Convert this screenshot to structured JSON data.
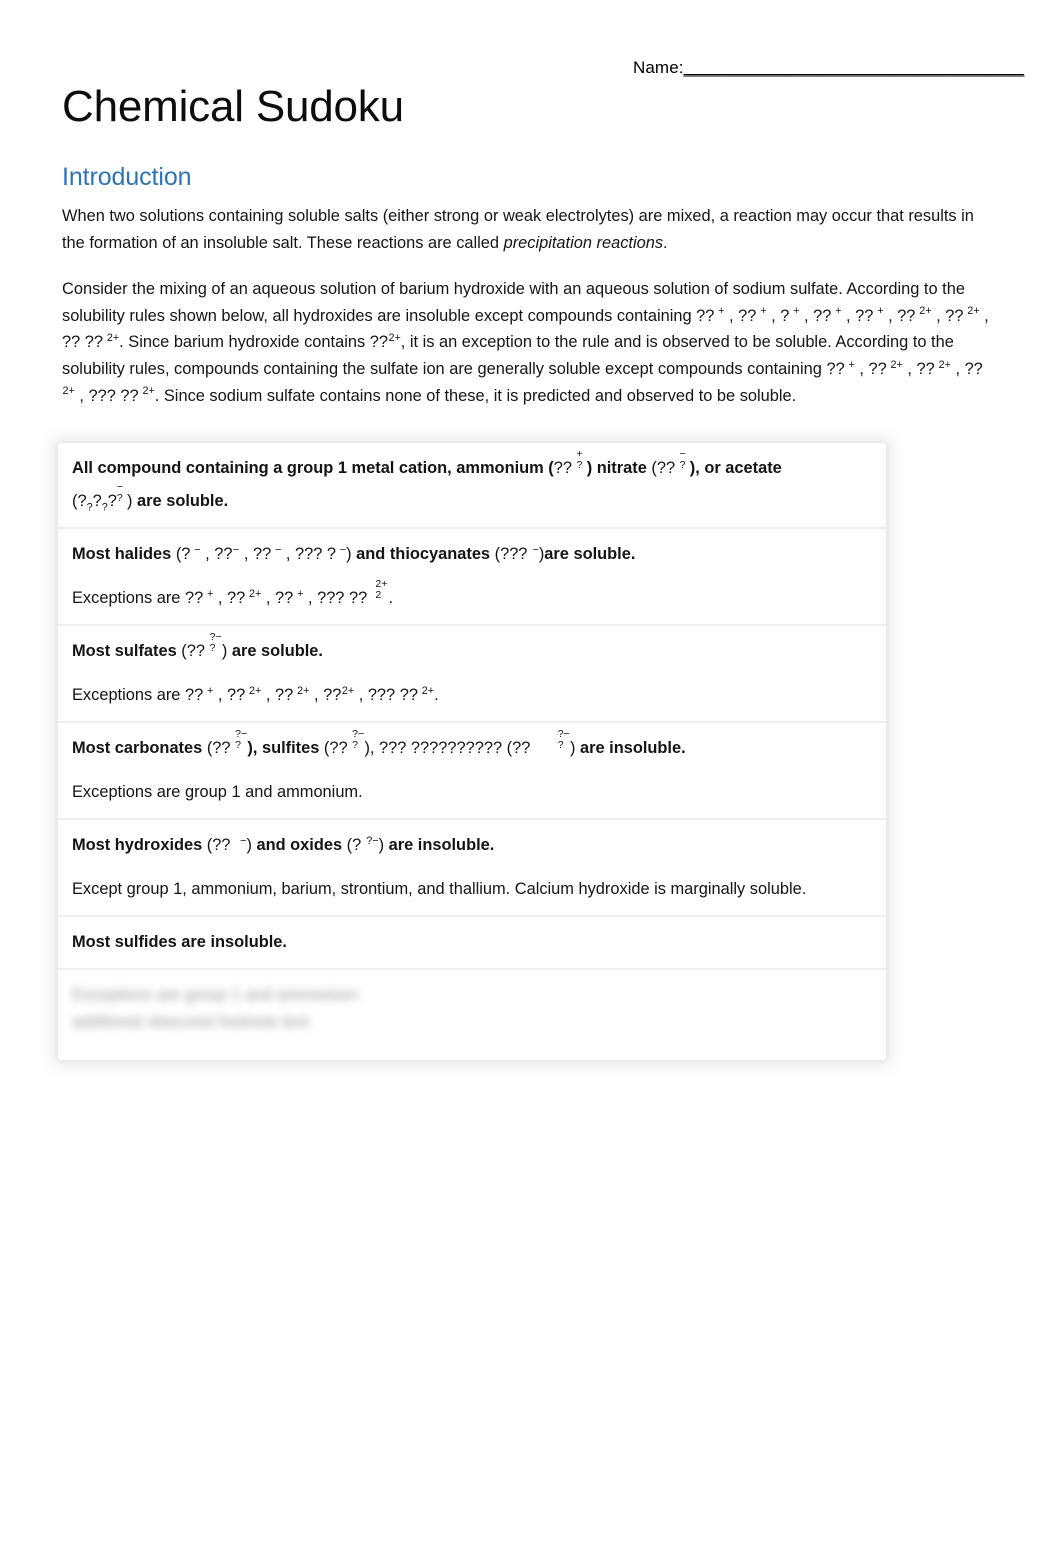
{
  "header": {
    "name_label": "Name:",
    "name_rule": "______________________________________",
    "title": "Chemical Sudoku"
  },
  "intro": {
    "heading": "Introduction",
    "paragraph_1_part_1": "When two solutions containing soluble salts (either strong or weak electrolytes) are mixed, a reaction may occur that results in the formation of an insoluble salt.  These reactions are called ",
    "paragraph_1_italic": "precipitation reactions",
    "paragraph_1_part_2": ".",
    "paragraph_2_part_1": "Consider the mixing of an aqueous solution of barium hydroxide with an aqueous solution of sodium sulfate.  According to the solubility rules shown below, all hydroxides are insoluble except compounds containing ",
    "ions_list_1": [
      {
        "symbol": "??",
        "charge": "+"
      },
      {
        "symbol": "??",
        "charge": "+"
      },
      {
        "symbol": "?",
        "charge": "+"
      },
      {
        "symbol": "??",
        "charge": "+"
      },
      {
        "symbol": "??",
        "charge": "+"
      },
      {
        "symbol": "??",
        "charge": "2+"
      },
      {
        "symbol": "??",
        "charge": "2+"
      },
      {
        "symbol": "?? ??",
        "charge": "2+"
      }
    ],
    "paragraph_2_part_2": ". Since barium hydroxide contains ",
    "barium_symbol": "??",
    "barium_charge": "2+",
    "paragraph_2_part_3": ", it is an exception to the rule and is observed to be soluble.  According to the solubility rules, compounds containing the sulfate ion are generally soluble except compounds containing ",
    "ions_list_2": [
      {
        "symbol": "??",
        "charge": "+"
      },
      {
        "symbol": "??",
        "charge": "2+"
      },
      {
        "symbol": "??",
        "charge": "2+"
      },
      {
        "symbol": "??",
        "charge": "2+"
      },
      {
        "symbol": "??? ??",
        "charge": "2+"
      }
    ],
    "paragraph_2_part_4": ". Since sodium sulfate contains none of these, it is predicted and observed to be soluble."
  },
  "rules": {
    "row1": {
      "bold_1": "All compound containing a group 1 metal cation, ammonium ",
      "open_1": "(",
      "ammonium_symbol": "??",
      "ammonium_top": "+",
      "ammonium_bot": "?",
      "close_1": ") ",
      "bold_2": "nitrate ",
      "open_2": "(",
      "nitrate_symbol": "??",
      "nitrate_top": "−",
      "nitrate_bot": "?",
      "close_2": "), or acetate",
      "line2_open": "(",
      "acetate_a": "?",
      "acetate_a_sub": "?",
      "acetate_b": "?",
      "acetate_b_sub": "?",
      "acetate_c": "?",
      "acetate_c_top": "−",
      "acetate_c_bot": "?",
      "line2_close": ") ",
      "line2_bold": "are soluble."
    },
    "row2": {
      "bold_1": "Most halides ",
      "halide_open": "(",
      "halides": [
        {
          "symbol": "?",
          "charge": "−",
          "spaced": true
        },
        {
          "symbol": "??",
          "charge": "−",
          "spaced": false
        },
        {
          "symbol": "??",
          "charge": "−",
          "spaced": true
        },
        {
          "symbol": "??? ?",
          "charge": "−",
          "spaced": true
        }
      ],
      "halide_close": ") ",
      "bold_2": "and thiocyanates ",
      "thio_open": "(",
      "thio_symbol": "???",
      "thio_charge": "−",
      "thio_close": ")",
      "bold_3": "are soluble.",
      "exceptions_prefix": "Exceptions are ",
      "exceptions": [
        {
          "symbol": "??",
          "charge": "+",
          "stacked": false
        },
        {
          "symbol": "??",
          "charge": "2+",
          "stacked": false
        },
        {
          "symbol": "??",
          "charge": "+",
          "stacked": false
        },
        {
          "symbol": "??? ??",
          "top": "2+",
          "bot": "2",
          "stacked": true
        }
      ],
      "exceptions_suffix": "."
    },
    "row3": {
      "bold_1": "Most sulfates ",
      "open": "(",
      "sulfate_symbol": "??",
      "sulfate_top": "?−",
      "sulfate_bot": "?",
      "close": ") ",
      "bold_2": "are soluble.",
      "exceptions_prefix": "Exceptions are ",
      "exceptions": [
        {
          "symbol": "??",
          "charge": "+",
          "gap": true
        },
        {
          "symbol": "??",
          "charge": "2+",
          "gap": true
        },
        {
          "symbol": "??",
          "charge": "2+",
          "gap": true
        },
        {
          "symbol": "??",
          "charge": "2+",
          "gap": false
        },
        {
          "symbol": "??? ??",
          "charge": "2+",
          "gap": true
        }
      ],
      "exceptions_suffix": "."
    },
    "row4": {
      "bold_1": "Most carbonates ",
      "open_1": "(",
      "carbonate_symbol": "??",
      "carbonate_top": "?−",
      "carbonate_bot": "?",
      "close_1": "), ",
      "bold_2": "sulfites ",
      "open_2": "(",
      "sulfite_symbol": "??",
      "sulfite_top": "?−",
      "sulfite_bot": "?",
      "close_2": "), ",
      "phosphates_text": "??? ?????????? ",
      "open_3": "(",
      "phosphate_symbol": "??",
      "phosphate_top": "?−",
      "phosphate_bot": "?",
      "close_3": ") ",
      "bold_3": "are insoluble.",
      "exceptions": "Exceptions are group 1 and ammonium."
    },
    "row5": {
      "bold_1": "Most hydroxides ",
      "open_1": "(",
      "hydroxide_symbol": "??",
      "hydroxide_charge": "−",
      "close_1": ") ",
      "bold_2": "and oxides ",
      "open_2": "(",
      "oxide_symbol": "?",
      "oxide_charge": "?−",
      "close_2": ") ",
      "bold_3": "are insoluble.",
      "exceptions": "Except group 1, ammonium, barium, strontium, and thallium.  Calcium hydroxide is marginally soluble."
    },
    "row6": {
      "bold_1": "Most sulfides are insoluble."
    },
    "row7": {
      "obscured_line_1": "Exceptions are group 1 and ammonium",
      "obscured_line_2": "additional obscured footnote text"
    }
  }
}
